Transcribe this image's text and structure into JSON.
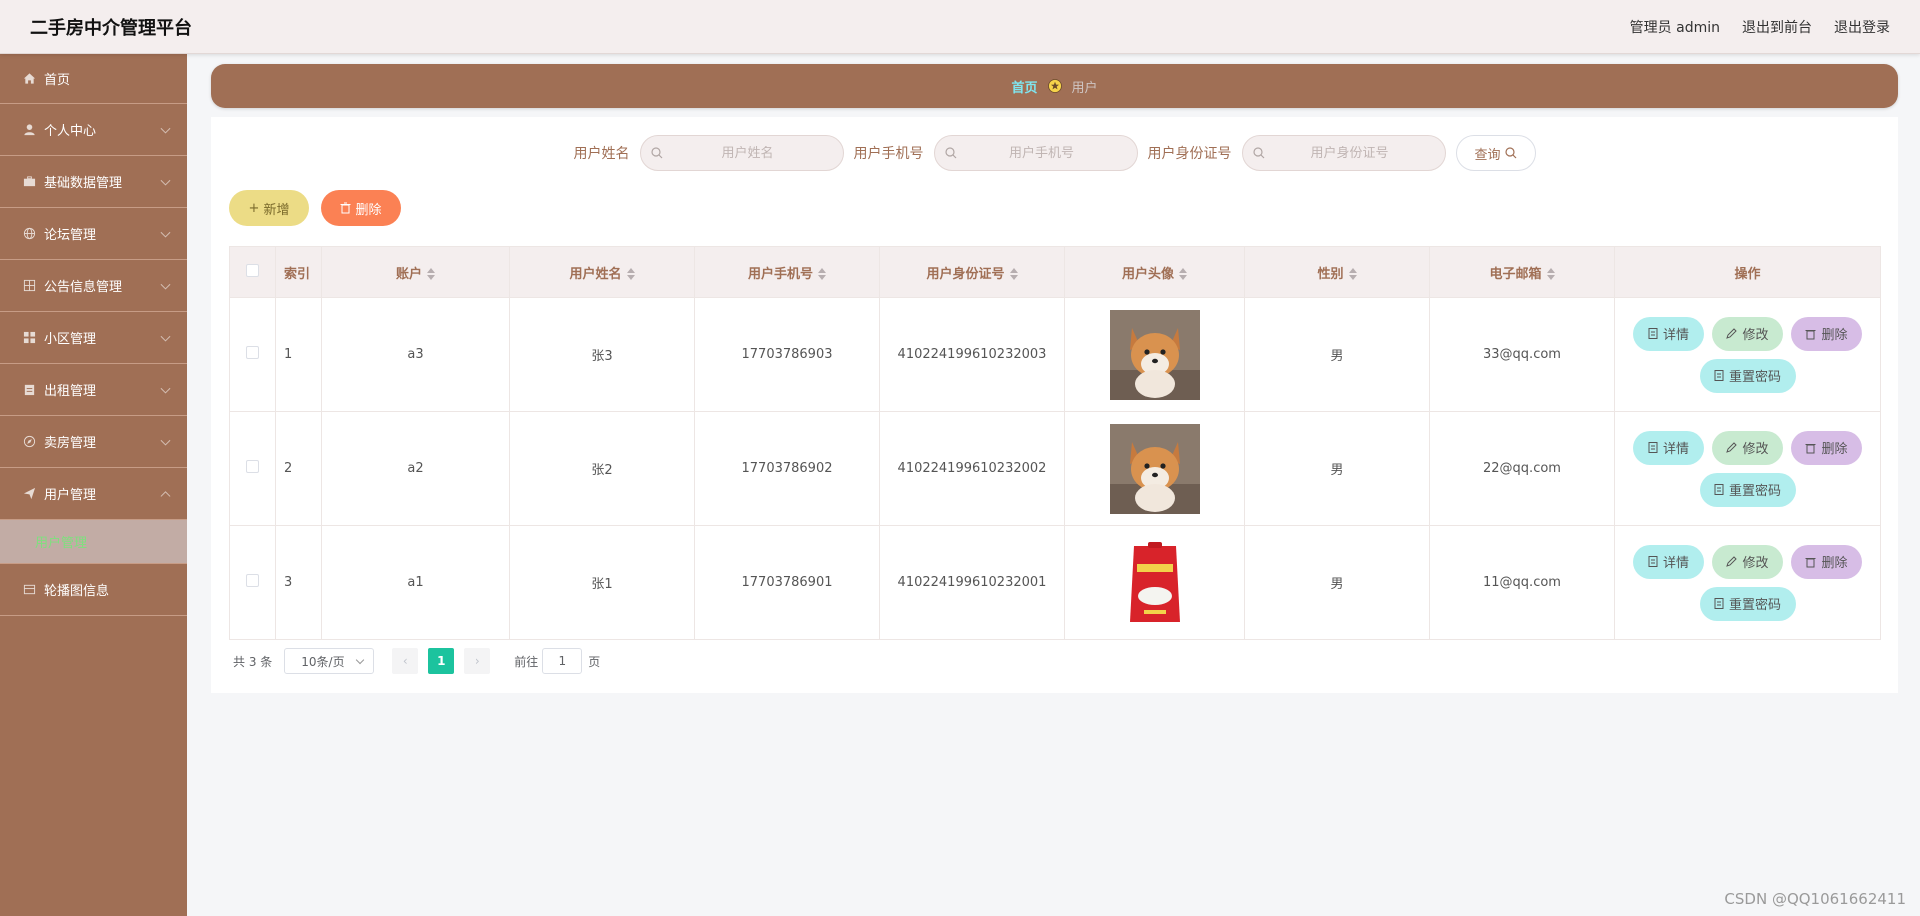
{
  "app": {
    "title": "二手房中介管理平台"
  },
  "header": {
    "admin": "管理员 admin",
    "front": "退出到前台",
    "logout": "退出登录"
  },
  "sidebar": {
    "items": [
      {
        "label": "首页",
        "icon": "home-icon"
      },
      {
        "label": "个人中心",
        "icon": "user-icon"
      },
      {
        "label": "基础数据管理",
        "icon": "briefcase-icon"
      },
      {
        "label": "论坛管理",
        "icon": "globe-icon"
      },
      {
        "label": "公告信息管理",
        "icon": "grid-icon"
      },
      {
        "label": "小区管理",
        "icon": "apps-icon"
      },
      {
        "label": "出租管理",
        "icon": "clipboard-icon"
      },
      {
        "label": "卖房管理",
        "icon": "compass-icon"
      },
      {
        "label": "用户管理",
        "icon": "send-icon"
      },
      {
        "label": "轮播图信息",
        "icon": "card-icon"
      }
    ],
    "active_sub": "用户管理"
  },
  "breadcrumb": {
    "home": "首页",
    "current": "用户"
  },
  "search": {
    "name_label": "用户姓名",
    "name_placeholder": "用户姓名",
    "phone_label": "用户手机号",
    "phone_placeholder": "用户手机号",
    "id_label": "用户身份证号",
    "id_placeholder": "用户身份证号",
    "query_label": "查询"
  },
  "actions": {
    "add_label": "新增",
    "delete_label": "删除"
  },
  "table": {
    "headers": {
      "index": "索引",
      "account": "账户",
      "name": "用户姓名",
      "phone": "用户手机号",
      "idcard": "用户身份证号",
      "avatar": "用户头像",
      "gender": "性别",
      "email": "电子邮箱",
      "ops": "操作"
    },
    "rows": [
      {
        "index": "1",
        "account": "a3",
        "name": "张3",
        "phone": "17703786903",
        "idcard": "410224199610232003",
        "avatar": "shiba-dog-photo",
        "gender": "男",
        "email": "33@qq.com"
      },
      {
        "index": "2",
        "account": "a2",
        "name": "张2",
        "phone": "17703786902",
        "idcard": "410224199610232002",
        "avatar": "shiba-dog-photo",
        "gender": "男",
        "email": "22@qq.com"
      },
      {
        "index": "3",
        "account": "a1",
        "name": "张1",
        "phone": "17703786901",
        "idcard": "410224199610232001",
        "avatar": "rice-bag-photo",
        "gender": "男",
        "email": "11@qq.com"
      }
    ],
    "op_labels": {
      "detail": "详情",
      "edit": "修改",
      "delete": "删除",
      "reset": "重置密码"
    }
  },
  "pagination": {
    "total": "共 3 条",
    "page_size": "10条/页",
    "current": "1",
    "goto_label": "前往",
    "goto_value": "1",
    "page_unit": "页"
  },
  "watermark": "CSDN @QQ1061662411",
  "colors": {
    "primary": "#a06f55",
    "highlight": "#7fe6f0",
    "page_active": "#1cc39e",
    "add": "#ecdc86",
    "delete": "#fb8154"
  }
}
